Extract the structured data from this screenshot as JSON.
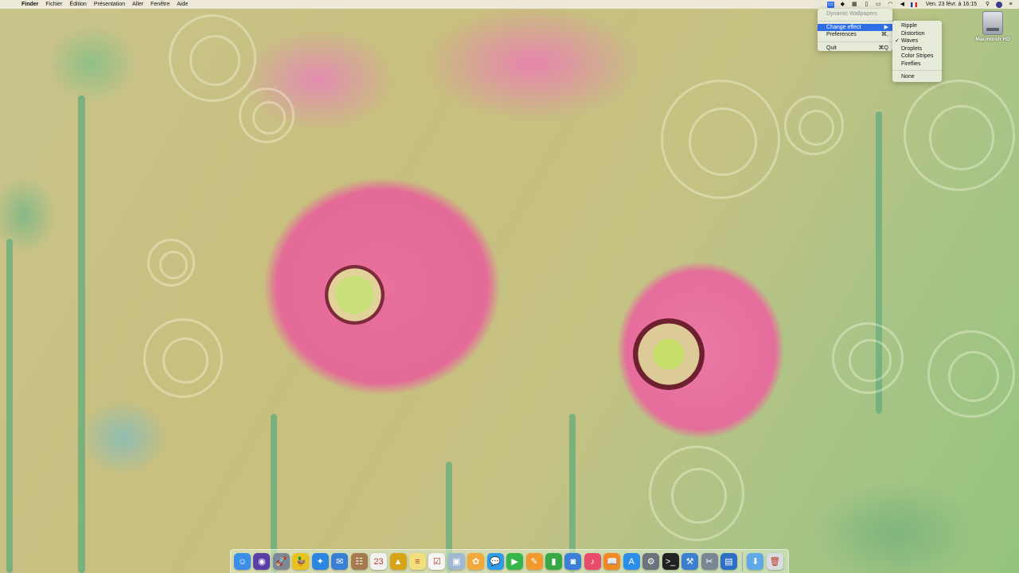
{
  "menubar": {
    "app_name": "Finder",
    "menus": [
      "Fichier",
      "Édition",
      "Présentation",
      "Aller",
      "Fenêtre",
      "Aide"
    ],
    "status_icons": [
      "dynamic-wallpapers-icon",
      "dropbox-icon",
      "grid-icon",
      "battery-icon",
      "airplay-icon",
      "wifi-icon",
      "volume-icon",
      "flag-fr-icon"
    ],
    "clock": "Ven. 23 févr. à 16:15"
  },
  "menu": {
    "title": "Dynamic Wallpapers",
    "change_effect": "Change effect",
    "preferences": "Preferences",
    "preferences_shortcut": "⌘,",
    "quit": "Quit",
    "quit_shortcut": "⌘Q",
    "effects": [
      "Ripple",
      "Distortion",
      "Waves",
      "Droplets",
      "Color Stripes",
      "Fireflies"
    ],
    "none": "None",
    "selected_effect": "Waves"
  },
  "desktop": {
    "drive_label": "Macintosh HD"
  },
  "dock": {
    "apps": [
      {
        "name": "finder-icon",
        "glyph": "☺",
        "color": "#3a8ee6"
      },
      {
        "name": "siri-icon",
        "glyph": "◉",
        "color": "#5b3fa8"
      },
      {
        "name": "launchpad-icon",
        "glyph": "🚀",
        "color": "#7d8894"
      },
      {
        "name": "cyberduck-icon",
        "glyph": "🦆",
        "color": "#e8c21f"
      },
      {
        "name": "safari-icon",
        "glyph": "✦",
        "color": "#2c86e0"
      },
      {
        "name": "mail-icon",
        "glyph": "✉",
        "color": "#3a7fd6"
      },
      {
        "name": "contacts-icon",
        "glyph": "☷",
        "color": "#a57a4e"
      },
      {
        "name": "calendar-icon",
        "glyph": "23",
        "color": "#f2f2f2"
      },
      {
        "name": "sublime-icon",
        "glyph": "▲",
        "color": "#d9a318"
      },
      {
        "name": "notes-icon",
        "glyph": "≡",
        "color": "#f3e07c"
      },
      {
        "name": "reminders-icon",
        "glyph": "☑",
        "color": "#f5f5f5"
      },
      {
        "name": "preview-icon",
        "glyph": "▣",
        "color": "#9fb8d0"
      },
      {
        "name": "photos-icon",
        "glyph": "✿",
        "color": "#f2a83a"
      },
      {
        "name": "messages-icon",
        "glyph": "💬",
        "color": "#2e9be8"
      },
      {
        "name": "facetime-icon",
        "glyph": "▶",
        "color": "#35b54a"
      },
      {
        "name": "pages-icon",
        "glyph": "✎",
        "color": "#f19a2b"
      },
      {
        "name": "numbers-icon",
        "glyph": "▮",
        "color": "#36a845"
      },
      {
        "name": "keynote-icon",
        "glyph": "◙",
        "color": "#3b7fd9"
      },
      {
        "name": "music-icon",
        "glyph": "♪",
        "color": "#e94b6a"
      },
      {
        "name": "ibooks-icon",
        "glyph": "📖",
        "color": "#f08a24"
      },
      {
        "name": "app-store-icon",
        "glyph": "A",
        "color": "#2b8ee8"
      },
      {
        "name": "system-preferences-icon",
        "glyph": "⚙",
        "color": "#6c737b"
      },
      {
        "name": "terminal-icon",
        "glyph": ">_",
        "color": "#222222"
      },
      {
        "name": "xcode-icon",
        "glyph": "⚒",
        "color": "#3c7ed0"
      },
      {
        "name": "utility-icon",
        "glyph": "✂",
        "color": "#7a8691"
      },
      {
        "name": "folder-icon",
        "glyph": "▤",
        "color": "#2d6fc7"
      }
    ],
    "trailing": [
      {
        "name": "downloads-folder-icon",
        "glyph": "⬇",
        "color": "#5fa9e8"
      },
      {
        "name": "trash-icon",
        "glyph": "🗑",
        "color": "#d8dde2"
      }
    ]
  }
}
